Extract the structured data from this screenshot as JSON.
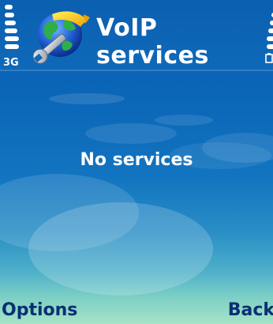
{
  "status": {
    "network_label": "3G"
  },
  "header": {
    "title": "VoIP services",
    "app_icon": "globe-wrench-icon"
  },
  "main": {
    "empty_message": "No services"
  },
  "softkeys": {
    "left_label": "Options",
    "right_label": "Back"
  },
  "colors": {
    "background_top": "#0a5fb3",
    "background_bottom": "#a6e3c6",
    "softkey_text": "#0a2f72",
    "text": "#ffffff"
  }
}
